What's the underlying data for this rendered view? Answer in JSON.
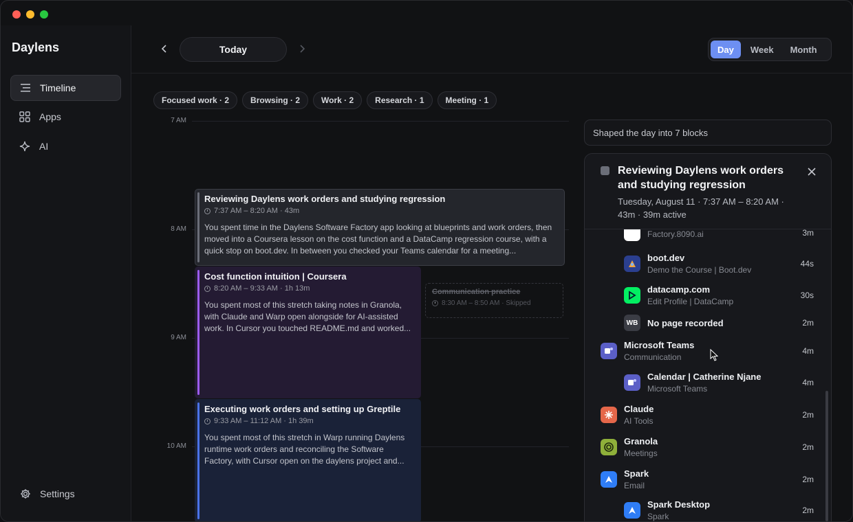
{
  "app": {
    "title": "Daylens"
  },
  "sidebar": {
    "items": [
      {
        "label": "Timeline",
        "icon": "timeline-icon",
        "active": true
      },
      {
        "label": "Apps",
        "icon": "apps-grid-icon",
        "active": false
      },
      {
        "label": "AI",
        "icon": "sparkle-icon",
        "active": false
      }
    ],
    "settings_label": "Settings"
  },
  "topbar": {
    "today_label": "Today",
    "views": [
      "Day",
      "Week",
      "Month"
    ],
    "active_view": "Day"
  },
  "chips": [
    "Focused work · 2",
    "Browsing · 2",
    "Work · 2",
    "Research · 1",
    "Meeting · 1"
  ],
  "timeline": {
    "hours": [
      "7 AM",
      "8 AM",
      "9 AM",
      "10 AM"
    ],
    "blocks": [
      {
        "title": "Reviewing Daylens work orders and studying regression",
        "time": "7:37 AM – 8:20 AM · 43m",
        "desc": "You spent time in the Daylens Software Factory app looking at blueprints and work orders, then moved into a Coursera lesson on the cost function and a DataCamp regression course, with a quick stop on boot.dev. In between you checked your Teams calendar for a meeting...",
        "color": "#6b6e78"
      },
      {
        "title": "Cost function intuition | Coursera",
        "time": "8:20 AM – 9:33 AM · 1h 13m",
        "desc": "You spent most of this stretch taking notes in Granola, with Claude and Warp open alongside for AI-assisted work. In Cursor you touched README.md and worked...",
        "color": "#9b5bf0"
      },
      {
        "title": "Executing work orders and setting up Greptile",
        "time": "9:33 AM – 11:12 AM · 1h 39m",
        "desc": "You spent most of this stretch in Warp running Daylens runtime work orders and reconciling the Software Factory, with Cursor open on the daylens project and...",
        "color": "#4a72e8"
      }
    ],
    "skipped": {
      "title": "Communication practice",
      "time": "8:30 AM – 8:50 AM · Skipped"
    }
  },
  "summary": "Shaped the day into 7 blocks",
  "detail": {
    "title": "Reviewing Daylens work orders and studying regression",
    "meta": "Tuesday, August 11 · 7:37 AM – 8:20 AM · 43m · 39m active",
    "rows": [
      {
        "level": 2,
        "name": "",
        "sub": "Factory.8090.ai",
        "dur": "3m",
        "icon": "factory-icon",
        "icon_bg": "#ffffff",
        "icon_text": ""
      },
      {
        "level": 2,
        "name": "boot.dev",
        "sub": "Demo the Course | Boot.dev",
        "dur": "44s",
        "icon": "bootdev-icon",
        "icon_bg": "#2b3f8f",
        "icon_text": ""
      },
      {
        "level": 2,
        "name": "datacamp.com",
        "sub": "Edit Profile | DataCamp",
        "dur": "30s",
        "icon": "datacamp-icon",
        "icon_bg": "#03ef62",
        "icon_text": ""
      },
      {
        "level": 2,
        "name": "No page recorded",
        "sub": "",
        "dur": "2m",
        "icon": "web-browser-icon",
        "icon_bg": "#3a3c44",
        "icon_text": "WB"
      },
      {
        "level": 1,
        "name": "Microsoft Teams",
        "sub": "Communication",
        "dur": "4m",
        "icon": "teams-icon",
        "icon_bg": "#5b5fc7",
        "icon_text": ""
      },
      {
        "level": 2,
        "name": "Calendar | Catherine Njane",
        "sub": "Microsoft Teams",
        "dur": "4m",
        "icon": "teams-icon",
        "icon_bg": "#5b5fc7",
        "icon_text": ""
      },
      {
        "level": 1,
        "name": "Claude",
        "sub": "AI Tools",
        "dur": "2m",
        "icon": "claude-icon",
        "icon_bg": "#e5674a",
        "icon_text": ""
      },
      {
        "level": 1,
        "name": "Granola",
        "sub": "Meetings",
        "dur": "2m",
        "icon": "granola-icon",
        "icon_bg": "#8fb03a",
        "icon_text": ""
      },
      {
        "level": 1,
        "name": "Spark",
        "sub": "Email",
        "dur": "2m",
        "icon": "spark-icon",
        "icon_bg": "#2f7df6",
        "icon_text": ""
      },
      {
        "level": 2,
        "name": "Spark Desktop",
        "sub": "Spark",
        "dur": "2m",
        "icon": "spark-icon",
        "icon_bg": "#2f7df6",
        "icon_text": ""
      }
    ]
  },
  "colors": {
    "accent": "#6d8ff2",
    "background": "#111214"
  }
}
